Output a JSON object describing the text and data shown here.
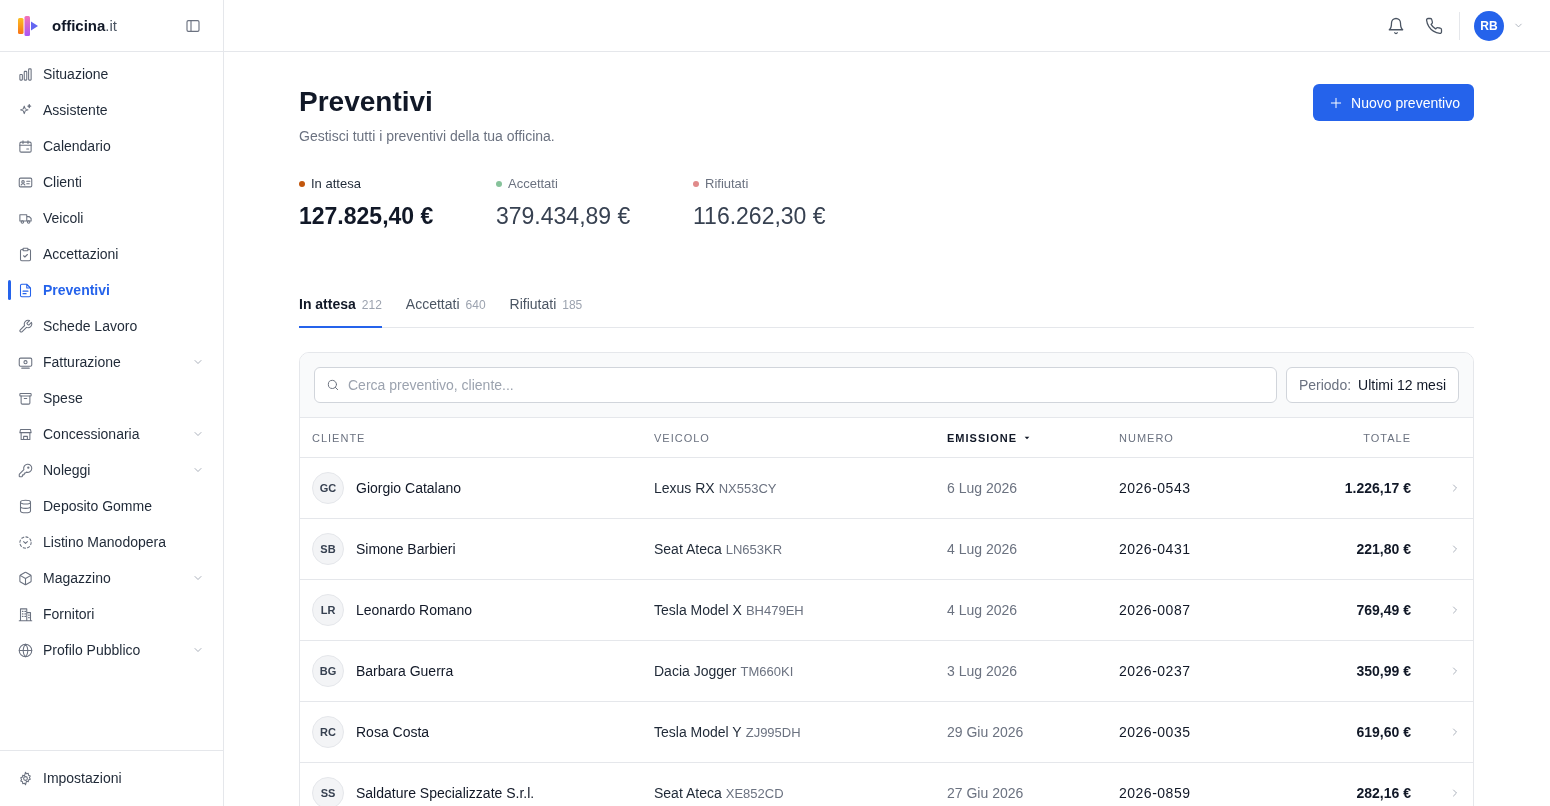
{
  "sidebar": {
    "brand": "**officina**.it",
    "items": [
      {
        "label": "Situazione",
        "kind": "link",
        "selected": false
      },
      {
        "label": "Assistente",
        "kind": "link",
        "selected": false
      },
      {
        "label": "Calendario",
        "kind": "link",
        "selected": false
      },
      {
        "label": "Clienti",
        "kind": "link",
        "selected": false
      },
      {
        "label": "Veicoli",
        "kind": "link",
        "selected": false
      },
      {
        "label": "Accettazioni",
        "kind": "link",
        "selected": false
      },
      {
        "label": "Preventivi",
        "kind": "link",
        "selected": true
      },
      {
        "label": "Schede Lavoro",
        "kind": "link",
        "selected": false
      },
      {
        "label": "Fatturazione",
        "kind": "group",
        "selected": false
      },
      {
        "label": "Spese",
        "kind": "link",
        "selected": false
      },
      {
        "label": "Concessionaria",
        "kind": "group",
        "selected": false
      },
      {
        "label": "Noleggi",
        "kind": "group",
        "selected": false
      },
      {
        "label": "Deposito Gomme",
        "kind": "link",
        "selected": false
      },
      {
        "label": "Listino Manodopera",
        "kind": "link",
        "selected": false
      },
      {
        "label": "Magazzino",
        "kind": "group",
        "selected": false
      },
      {
        "label": "Fornitori",
        "kind": "link",
        "selected": false
      },
      {
        "label": "Profilo Pubblico",
        "kind": "group",
        "selected": false
      }
    ],
    "footer_items": [
      {
        "label": "Impostazioni",
        "selected": false
      }
    ]
  },
  "header": {
    "avatar_initials": "RB"
  },
  "page": {
    "title": "Preventivi",
    "subtitle": "Gestisci tutti i preventivi della tua officina.",
    "action": "Nuovo preventivo"
  },
  "stats": [
    {
      "label": "In attesa",
      "value": "127.825,40 €",
      "color": "#c2560c",
      "selected": true
    },
    {
      "label": "Accettati",
      "value": "379.434,89 €",
      "color": "#86c29a",
      "selected": false
    },
    {
      "label": "Rifiutati",
      "value": "116.262,30 €",
      "color": "#e08a8a",
      "selected": false
    }
  ],
  "tabs": [
    {
      "label": "In attesa",
      "count": "212",
      "selected": true
    },
    {
      "label": "Accettati",
      "count": "640",
      "selected": false
    },
    {
      "label": "Rifiutati",
      "count": "185",
      "selected": false
    }
  ],
  "search": {
    "placeholder": "Cerca preventivo, cliente..."
  },
  "period": {
    "label": "Periodo:",
    "value": "Ultimi 12 mesi"
  },
  "table": {
    "columns": [
      {
        "label": "CLIENTE",
        "sorted": false
      },
      {
        "label": "VEICOLO",
        "sorted": false
      },
      {
        "label": "EMISSIONE",
        "sorted": true
      },
      {
        "label": "NUMERO",
        "sorted": false
      },
      {
        "label": "TOTALE",
        "sorted": false
      }
    ],
    "rows": [
      {
        "initials": "GC",
        "client": "Giorgio Catalano",
        "vehicle": "Lexus RX",
        "plate": "NX553CY",
        "date": "6 Lug 2026",
        "number": "2026-0543",
        "total": "1.226,17 €"
      },
      {
        "initials": "SB",
        "client": "Simone Barbieri",
        "vehicle": "Seat Ateca",
        "plate": "LN653KR",
        "date": "4 Lug 2026",
        "number": "2026-0431",
        "total": "221,80 €"
      },
      {
        "initials": "LR",
        "client": "Leonardo Romano",
        "vehicle": "Tesla Model X",
        "plate": "BH479EH",
        "date": "4 Lug 2026",
        "number": "2026-0087",
        "total": "769,49 €"
      },
      {
        "initials": "BG",
        "client": "Barbara Guerra",
        "vehicle": "Dacia Jogger",
        "plate": "TM660KI",
        "date": "3 Lug 2026",
        "number": "2026-0237",
        "total": "350,99 €"
      },
      {
        "initials": "RC",
        "client": "Rosa Costa",
        "vehicle": "Tesla Model Y",
        "plate": "ZJ995DH",
        "date": "29 Giu 2026",
        "number": "2026-0035",
        "total": "619,60 €"
      },
      {
        "initials": "SS",
        "client": "Saldature Specializzate S.r.l.",
        "vehicle": "Seat Ateca",
        "plate": "XE852CD",
        "date": "27 Giu 2026",
        "number": "2026-0859",
        "total": "282,16 €"
      }
    ]
  }
}
